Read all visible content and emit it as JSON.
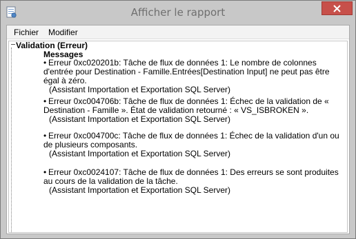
{
  "window": {
    "title": "Afficher le rapport",
    "close_label": "✕"
  },
  "menubar": {
    "items": [
      "Fichier",
      "Modifier"
    ]
  },
  "report": {
    "section_title": "Validation (Erreur)",
    "messages_label": "Messages",
    "messages": [
      {
        "text": "Erreur 0xc020201b: Tâche de flux de données 1: Le nombre de colonnes d'entrée pour Destination - Famille.Entrées[Destination Input] ne peut pas être égal à zéro.",
        "source": "(Assistant Importation et Exportation SQL Server)"
      },
      {
        "text": "Erreur 0xc004706b: Tâche de flux de données 1: Échec de la validation de « Destination - Famille ». État de validation retourné : « VS_ISBROKEN ».",
        "source": "(Assistant Importation et Exportation SQL Server)"
      },
      {
        "text": "Erreur 0xc004700c: Tâche de flux de données 1: Échec de la validation d'un ou de plusieurs composants.",
        "source": "(Assistant Importation et Exportation SQL Server)"
      },
      {
        "text": "Erreur 0xc0024107: Tâche de flux de données 1: Des erreurs se sont produites au cours de la validation de la tâche.",
        "source": "(Assistant Importation et Exportation SQL Server)"
      }
    ]
  }
}
